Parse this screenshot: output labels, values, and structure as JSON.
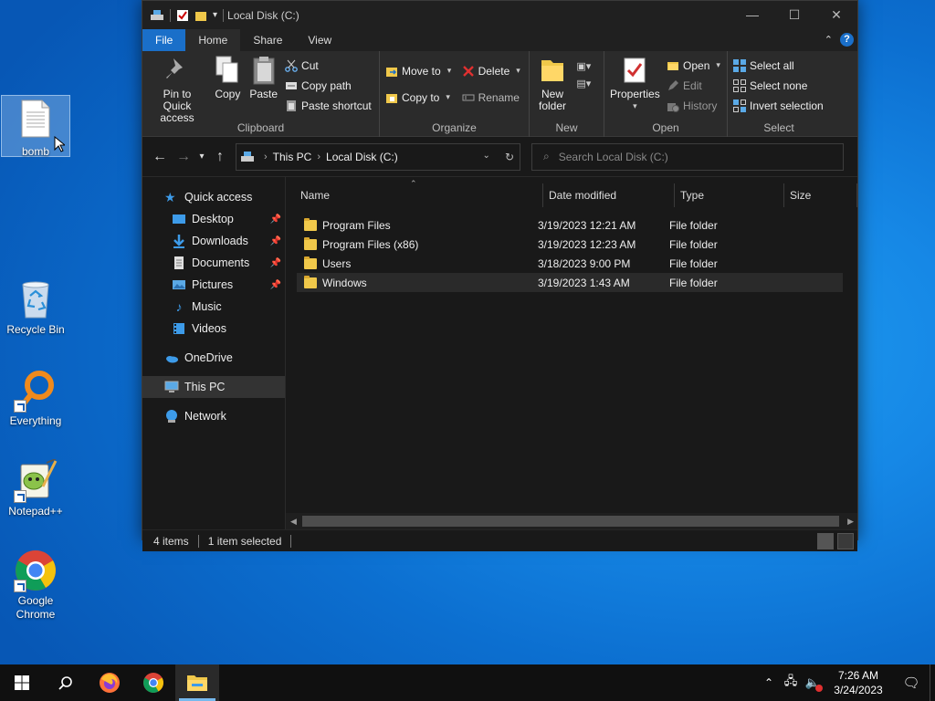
{
  "desktop": {
    "icons": [
      {
        "label": "bomb"
      },
      {
        "label": "Recycle Bin"
      },
      {
        "label": "Everything"
      },
      {
        "label": "Notepad++"
      },
      {
        "label": "Google Chrome"
      }
    ]
  },
  "window": {
    "title": "Local Disk (C:)",
    "tabs": [
      "File",
      "Home",
      "Share",
      "View"
    ],
    "ribbon": {
      "clipboard": {
        "label": "Clipboard",
        "pin": "Pin to Quick access",
        "copy": "Copy",
        "paste": "Paste",
        "cut": "Cut",
        "copy_path": "Copy path",
        "paste_shortcut": "Paste shortcut"
      },
      "organize": {
        "label": "Organize",
        "move_to": "Move to",
        "copy_to": "Copy to",
        "delete": "Delete",
        "rename": "Rename"
      },
      "new": {
        "label": "New",
        "new_folder": "New folder"
      },
      "open": {
        "label": "Open",
        "properties": "Properties",
        "open": "Open",
        "edit": "Edit",
        "history": "History"
      },
      "select": {
        "label": "Select",
        "select_all": "Select all",
        "select_none": "Select none",
        "invert": "Invert selection"
      }
    },
    "address": {
      "crumbs": [
        "This PC",
        "Local Disk (C:)"
      ],
      "search_placeholder": "Search Local Disk (C:)"
    },
    "nav": {
      "quick_access": "Quick access",
      "items": [
        {
          "label": "Desktop",
          "pinned": true
        },
        {
          "label": "Downloads",
          "pinned": true
        },
        {
          "label": "Documents",
          "pinned": true
        },
        {
          "label": "Pictures",
          "pinned": true
        },
        {
          "label": "Music",
          "pinned": false
        },
        {
          "label": "Videos",
          "pinned": false
        }
      ],
      "onedrive": "OneDrive",
      "this_pc": "This PC",
      "network": "Network"
    },
    "columns": {
      "name": "Name",
      "date": "Date modified",
      "type": "Type",
      "size": "Size"
    },
    "files": [
      {
        "name": "Program Files",
        "date": "3/19/2023 12:21 AM",
        "type": "File folder"
      },
      {
        "name": "Program Files (x86)",
        "date": "3/19/2023 12:23 AM",
        "type": "File folder"
      },
      {
        "name": "Users",
        "date": "3/18/2023 9:00 PM",
        "type": "File folder"
      },
      {
        "name": "Windows",
        "date": "3/19/2023 1:43 AM",
        "type": "File folder"
      }
    ],
    "status": {
      "count": "4 items",
      "selected": "1 item selected"
    }
  },
  "taskbar": {
    "time": "7:26 AM",
    "date": "3/24/2023"
  },
  "colors": {
    "accent": "#1a6fc9",
    "folder": "#f0c84a",
    "window_bg": "#191919"
  }
}
